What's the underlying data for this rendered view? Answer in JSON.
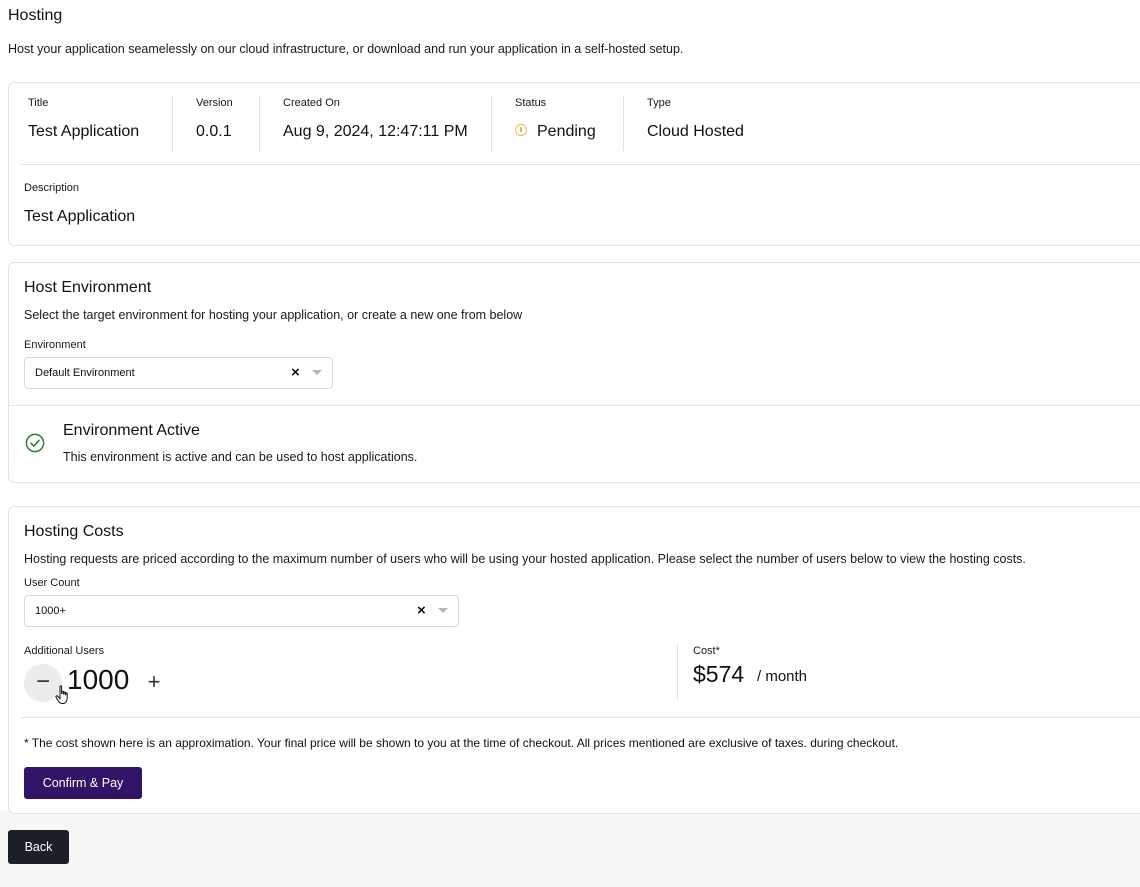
{
  "header": {
    "title": "Hosting",
    "subtitle": "Host your application seamelessly on our cloud infrastructure, or download and run your application in a self-hosted setup."
  },
  "details": {
    "fields": [
      {
        "label": "Title",
        "value": "Test Application"
      },
      {
        "label": "Version",
        "value": "0.0.1"
      },
      {
        "label": "Created On",
        "value": "Aug 9, 2024, 12:47:11 PM"
      },
      {
        "label": "Status",
        "value": "Pending",
        "icon": "pending-icon",
        "icon_color": "#e8b949"
      },
      {
        "label": "Type",
        "value": "Cloud Hosted"
      }
    ],
    "description_label": "Description",
    "description_value": "Test Application"
  },
  "environment": {
    "heading": "Host Environment",
    "subheading": "Select the target environment for hosting your application, or create a new one from below",
    "field_label": "Environment",
    "selected": "Default Environment",
    "status_heading": "Environment Active",
    "status_text": "This environment is active and can be used to host applications.",
    "status_icon": "check-circle-icon",
    "status_color": "#2e7d32"
  },
  "costs": {
    "heading": "Hosting Costs",
    "subheading": "Hosting requests are priced according to the maximum number of users who will be using your hosted application. Please select the number of users below to view the hosting costs.",
    "user_count_label": "User Count",
    "user_count_selected": "1000+",
    "additional_users_label": "Additional Users",
    "additional_users_value": "1000",
    "minus_symbol": "−",
    "plus_symbol": "+",
    "cost_label": "Cost*",
    "cost_value": "$574",
    "cost_unit": "/ month",
    "note": "* The cost shown here is an approximation. Your final price will be shown to you at the time of checkout. All prices mentioned are exclusive of taxes. during checkout.",
    "confirm_label": "Confirm & Pay"
  },
  "footer": {
    "back_label": "Back"
  },
  "colors": {
    "primary": "#2f1468",
    "back_button": "#1b1f27",
    "pending": "#e8b949",
    "success": "#2e7d32"
  }
}
